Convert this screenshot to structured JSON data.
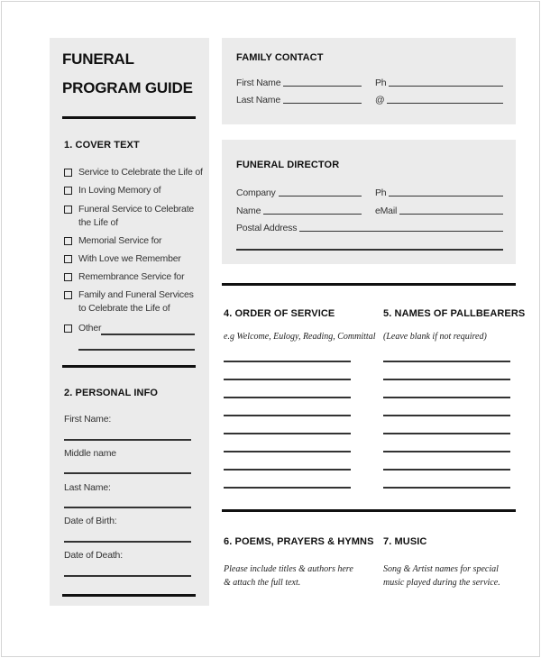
{
  "title_line1": "FUNERAL",
  "title_line2": "PROGRAM GUIDE",
  "cover_text": {
    "heading": "1. COVER TEXT",
    "options": [
      {
        "label": "Service to Celebrate the Life of",
        "checked": false
      },
      {
        "label": "In Loving Memory of",
        "checked": false
      },
      {
        "label": "Funeral Service to Celebrate the Life of",
        "checked": false
      },
      {
        "label": "Memorial Service for",
        "checked": false
      },
      {
        "label": "With Love we Remember",
        "checked": false
      },
      {
        "label": "Remembrance Service for",
        "checked": false
      },
      {
        "label": "Family and Funeral Services to Celebrate the Life of",
        "checked": false
      },
      {
        "label": "Other",
        "checked": false
      }
    ]
  },
  "personal_info": {
    "heading": "2. PERSONAL INFO",
    "fields": [
      "First Name:",
      "Middle name",
      "Last Name:",
      "Date of Birth:",
      "Date of Death:"
    ]
  },
  "family_contact": {
    "heading": "FAMILY CONTACT",
    "first_name": "First Name",
    "last_name": "Last Name",
    "phone": "Ph",
    "email": "@"
  },
  "funeral_director": {
    "heading": "FUNERAL DIRECTOR",
    "company": "Company",
    "name": "Name",
    "phone": "Ph",
    "email": "eMail",
    "postal_address": "Postal Address"
  },
  "order_of_service": {
    "heading": "4. ORDER OF SERVICE",
    "hint": "e.g Welcome, Eulogy, Reading, Committal",
    "line_count": 8
  },
  "pallbearers": {
    "heading": "5. NAMES OF PALLBEARERS",
    "hint": "(Leave blank if not required)",
    "line_count": 8
  },
  "poems": {
    "heading": "6. POEMS, PRAYERS & HYMNS",
    "hint": "Please include titles & authors here & attach the full text."
  },
  "music": {
    "heading": "7. MUSIC",
    "hint": "Song & Artist names for special music played during the service."
  }
}
